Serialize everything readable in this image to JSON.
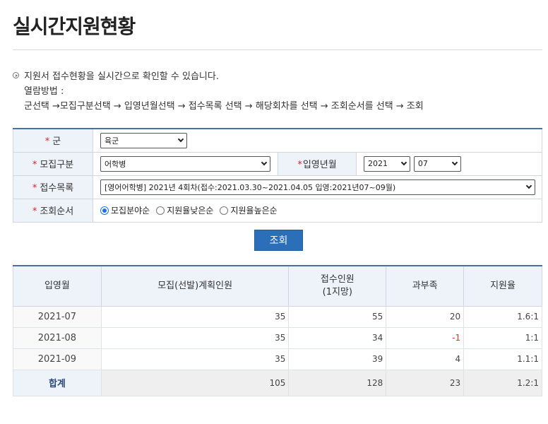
{
  "page": {
    "title": "실시간지원현황"
  },
  "info": {
    "lines": [
      "지원서 접수현황을 실시간으로 확인할 수 있습니다.",
      "열람방법 :",
      "군선택 →모집구분선택 → 입영년월선택 → 접수목록 선택 → 해당회차를 선택 → 조회순서를 선택 → 조회"
    ]
  },
  "form": {
    "branch": {
      "label": "군",
      "value": "육군"
    },
    "recruit_type": {
      "label": "모집구분",
      "value": "어학병"
    },
    "enlist_month": {
      "label": "입영년월",
      "year": "2021",
      "month": "07"
    },
    "application": {
      "label": "접수목록",
      "value": "[영어어학병] 2021년 4회차(접수:2021.03.30~2021.04.05 입영:2021년07~09월)"
    },
    "sort": {
      "label": "조회순서",
      "options": [
        "모집분야순",
        "지원율낮은순",
        "지원율높은순"
      ],
      "selected_index": 0
    },
    "required_mark": "*"
  },
  "search_button": "조회",
  "results": {
    "headers": [
      "입영월",
      "모집(선발)계획인원",
      "접수인원",
      "(1지망)",
      "과부족",
      "지원율"
    ],
    "rows": [
      {
        "month": "2021-07",
        "planned": "35",
        "applied": "55",
        "diff": "20",
        "rate": "1.6:1",
        "negative": false
      },
      {
        "month": "2021-08",
        "planned": "35",
        "applied": "34",
        "diff": "-1",
        "rate": "1:1",
        "negative": true
      },
      {
        "month": "2021-09",
        "planned": "35",
        "applied": "39",
        "diff": "4",
        "rate": "1.1:1",
        "negative": false
      }
    ],
    "total": {
      "label": "합계",
      "planned": "105",
      "applied": "128",
      "diff": "23",
      "rate": "1.2:1"
    }
  }
}
